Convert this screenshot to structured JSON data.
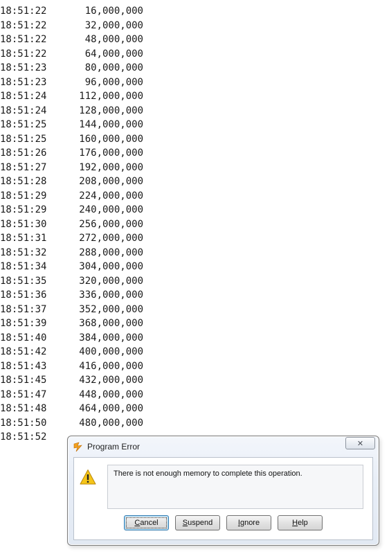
{
  "log": {
    "rows": [
      {
        "time": "18:51:22",
        "value": "16,000,000"
      },
      {
        "time": "18:51:22",
        "value": "32,000,000"
      },
      {
        "time": "18:51:22",
        "value": "48,000,000"
      },
      {
        "time": "18:51:22",
        "value": "64,000,000"
      },
      {
        "time": "18:51:23",
        "value": "80,000,000"
      },
      {
        "time": "18:51:23",
        "value": "96,000,000"
      },
      {
        "time": "18:51:24",
        "value": "112,000,000"
      },
      {
        "time": "18:51:24",
        "value": "128,000,000"
      },
      {
        "time": "18:51:25",
        "value": "144,000,000"
      },
      {
        "time": "18:51:25",
        "value": "160,000,000"
      },
      {
        "time": "18:51:26",
        "value": "176,000,000"
      },
      {
        "time": "18:51:27",
        "value": "192,000,000"
      },
      {
        "time": "18:51:28",
        "value": "208,000,000"
      },
      {
        "time": "18:51:29",
        "value": "224,000,000"
      },
      {
        "time": "18:51:29",
        "value": "240,000,000"
      },
      {
        "time": "18:51:30",
        "value": "256,000,000"
      },
      {
        "time": "18:51:31",
        "value": "272,000,000"
      },
      {
        "time": "18:51:32",
        "value": "288,000,000"
      },
      {
        "time": "18:51:34",
        "value": "304,000,000"
      },
      {
        "time": "18:51:35",
        "value": "320,000,000"
      },
      {
        "time": "18:51:36",
        "value": "336,000,000"
      },
      {
        "time": "18:51:37",
        "value": "352,000,000"
      },
      {
        "time": "18:51:39",
        "value": "368,000,000"
      },
      {
        "time": "18:51:40",
        "value": "384,000,000"
      },
      {
        "time": "18:51:42",
        "value": "400,000,000"
      },
      {
        "time": "18:51:43",
        "value": "416,000,000"
      },
      {
        "time": "18:51:45",
        "value": "432,000,000"
      },
      {
        "time": "18:51:47",
        "value": "448,000,000"
      },
      {
        "time": "18:51:48",
        "value": "464,000,000"
      },
      {
        "time": "18:51:50",
        "value": "480,000,000"
      },
      {
        "time": "18:51:52",
        "value": ""
      }
    ]
  },
  "dialog": {
    "title": "Program Error",
    "close_glyph": "✕",
    "app_icon": "app-lightning-icon",
    "warning_icon": "warning-icon",
    "message": "There is not enough memory to complete this operation.",
    "buttons": {
      "cancel": {
        "access_key": "C",
        "rest": "ancel"
      },
      "suspend": {
        "access_key": "S",
        "rest": "uspend"
      },
      "ignore": {
        "access_key": "I",
        "rest": "gnore"
      },
      "help": {
        "access_key": "H",
        "rest": "elp"
      }
    }
  },
  "colors": {
    "icon_orange": "#f0a020",
    "warning_yellow": "#f5c518"
  }
}
